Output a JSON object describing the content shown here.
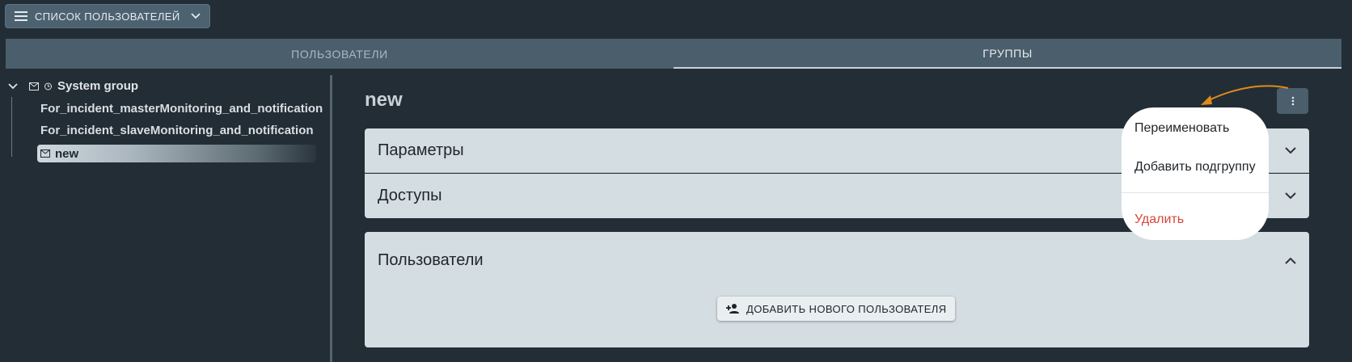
{
  "header": {
    "list_button_label": "Список пользователей"
  },
  "tabs": [
    {
      "label": "Пользователи",
      "active": false
    },
    {
      "label": "Группы",
      "active": true
    }
  ],
  "tree": {
    "root": {
      "label": "System group"
    },
    "items": [
      {
        "label": "For_incident_masterMonitoring_and_notification"
      },
      {
        "label": "For_incident_slaveMonitoring_and_notification"
      },
      {
        "label": "new",
        "selected": true
      }
    ]
  },
  "main": {
    "title": "new",
    "panels": [
      {
        "label": "Параметры",
        "expanded": false
      },
      {
        "label": "Доступы",
        "expanded": false
      },
      {
        "label": "Пользователи",
        "expanded": true
      }
    ],
    "add_user_label": "Добавить нового пользователя"
  },
  "menu": {
    "items": [
      {
        "label": "Переименовать"
      },
      {
        "label": "Добавить подгруппу"
      },
      {
        "label": "Удалить",
        "danger": true
      }
    ]
  },
  "colors": {
    "accent_arrow": "#e08a1e",
    "danger": "#d8443b",
    "background": "#232d35"
  }
}
